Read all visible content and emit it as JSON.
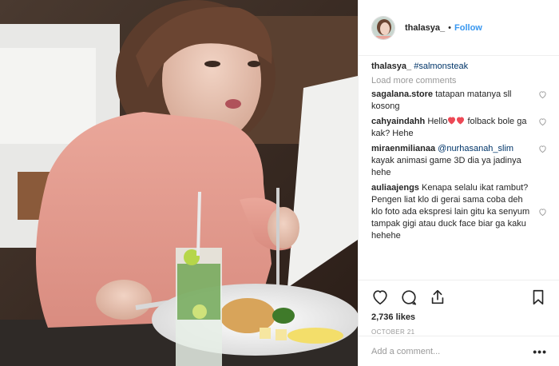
{
  "post": {
    "image_description_icon": "post-photo",
    "author": {
      "username": "thalasya_",
      "follow_label": "Follow",
      "separator": "•"
    },
    "caption": {
      "username": "thalasya_",
      "hashtag": "#salmonsteak"
    },
    "load_more_label": "Load more comments",
    "comments": [
      {
        "username": "sagalana.store",
        "text": "tatapan matanya sll kosong"
      },
      {
        "username": "cahyaindahh",
        "text_before": "Hello",
        "emoji": "heart-emoji",
        "text_after": " folback bole ga kak? Hehe"
      },
      {
        "username": "miraenmilianaa",
        "mention": "@nurhasanah_slim",
        "text": " kayak animasi game 3D dia ya jadinya hehe"
      },
      {
        "username": "auliaajengs",
        "text": "Kenapa selalu ikat rambut? Pengen liat klo di gerai sama coba deh klo foto ada ekspresi lain gitu ka senyum tampak gigi atau duck face biar ga kaku hehehe"
      }
    ],
    "likes": "2,736 likes",
    "date": "OCTOBER 21",
    "add_comment_placeholder": "Add a comment...",
    "more_options_label": "•••"
  },
  "colors": {
    "link_blue": "#3897f0",
    "hashtag_blue": "#003569",
    "muted_gray": "#999999",
    "heart_red": "#ed4956",
    "text_dark": "#262626"
  }
}
